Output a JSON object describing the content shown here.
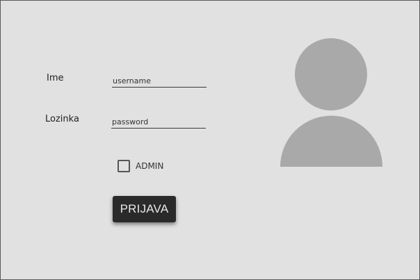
{
  "form": {
    "username_label": "Ime",
    "username_placeholder": "username",
    "password_label": "Lozinka",
    "password_placeholder": "password",
    "admin_label": "ADMIN",
    "admin_checked": false,
    "submit_label": "PRIJAVA"
  },
  "avatar": {
    "icon": "user-avatar-icon",
    "color": "#a9a9a9"
  }
}
